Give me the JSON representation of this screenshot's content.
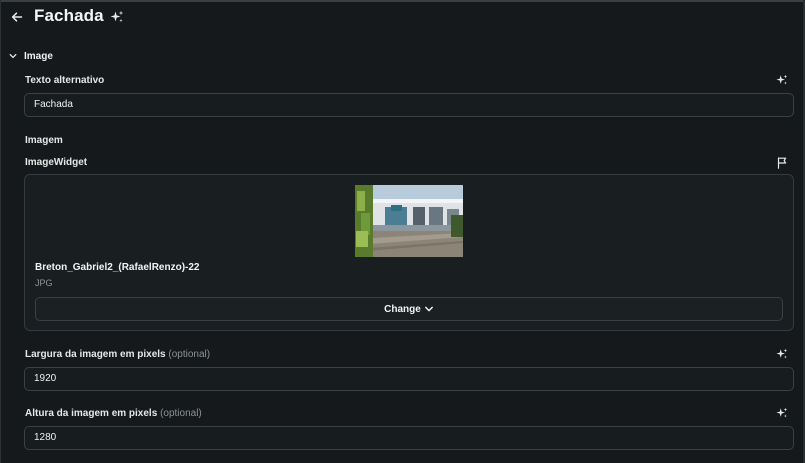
{
  "header": {
    "title": "Fachada",
    "back_icon": "arrow-left-icon",
    "assist_icon": "sparkle-icon"
  },
  "section": {
    "label": "Image",
    "expanded": true,
    "icon": "chevron-down-icon"
  },
  "fields": {
    "alt_text": {
      "label": "Texto alternativo",
      "value": "Fachada"
    },
    "image": {
      "group_label": "Imagem",
      "widget_label": "ImageWidget",
      "file_name": "Breton_Gabriel2_(RafaelRenzo)-22",
      "file_type": "JPG",
      "change_label": "Change"
    },
    "width": {
      "label": "Largura da imagem em pixels",
      "optional": "(optional)",
      "value": "1920"
    },
    "height": {
      "label": "Altura da imagem em pixels",
      "optional": "(optional)",
      "value": "1280"
    }
  },
  "colors": {
    "background": "#15191b",
    "input_border": "#3a4144",
    "muted_text": "#8b9295"
  }
}
